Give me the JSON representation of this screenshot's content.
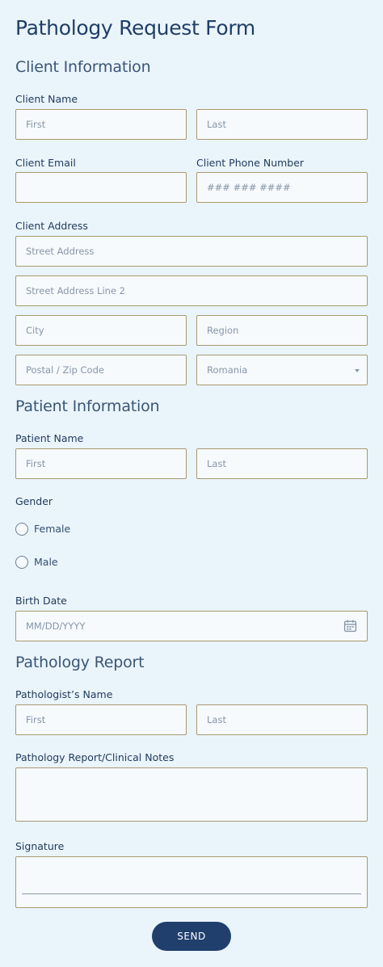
{
  "form": {
    "title": "Pathology Request Form",
    "send_label": "SEND"
  },
  "client": {
    "section_title": "Client Information",
    "name_label": "Client Name",
    "first_placeholder": "First",
    "last_placeholder": "Last",
    "email_label": "Client Email",
    "email_value": "",
    "phone_label": "Client Phone Number",
    "phone_placeholder": "### ### ####",
    "address_label": "Client Address",
    "street_placeholder": "Street Address",
    "street2_placeholder": "Street Address Line 2",
    "city_placeholder": "City",
    "region_placeholder": "Region",
    "postal_placeholder": "Postal / Zip Code",
    "country_selected": "Romania"
  },
  "patient": {
    "section_title": "Patient Information",
    "name_label": "Patient Name",
    "first_placeholder": "First",
    "last_placeholder": "Last",
    "gender_label": "Gender",
    "gender_options": [
      "Female",
      "Male"
    ],
    "birth_label": "Birth Date",
    "birth_placeholder": "MM/DD/YYYY"
  },
  "report": {
    "section_title": "Pathology Report",
    "pathologist_label": "Pathologist’s Name",
    "first_placeholder": "First",
    "last_placeholder": "Last",
    "notes_label": "Pathology Report/Clinical Notes",
    "signature_label": "Signature"
  },
  "icons": {
    "calendar": "calendar-icon",
    "dropdown": "chevron-down-icon"
  },
  "colors": {
    "background": "#eaf4fb",
    "field_border": "#a89a72",
    "heading": "#1f3f66",
    "button": "#213f6c"
  }
}
